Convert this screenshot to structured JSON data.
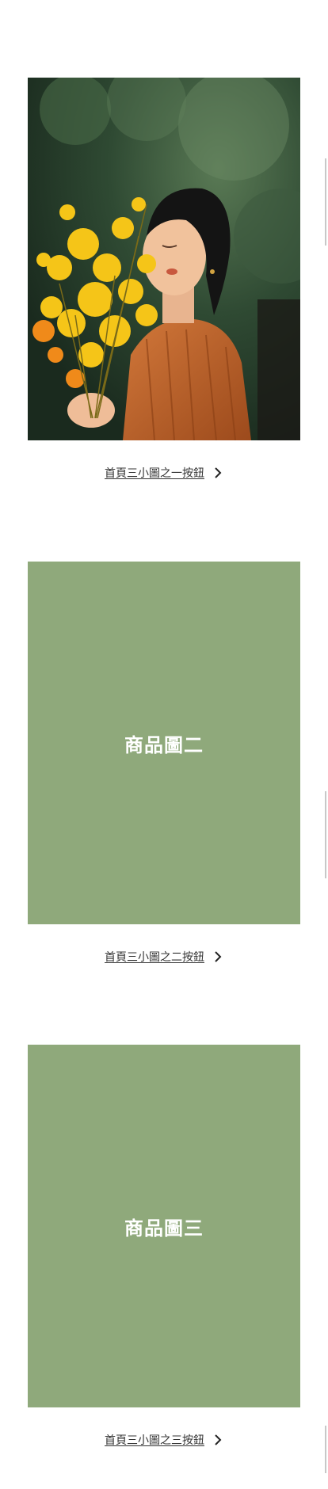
{
  "products": [
    {
      "image": {
        "type": "photo",
        "subject": "woman-with-yellow-flowers"
      },
      "button_label": "首頁三小圖之一按鈕"
    },
    {
      "image": {
        "type": "placeholder",
        "label": "商品圖二",
        "color": "#8fa97b"
      },
      "button_label": "首頁三小圖之二按鈕"
    },
    {
      "image": {
        "type": "placeholder",
        "label": "商品圖三",
        "color": "#8fa97b"
      },
      "button_label": "首頁三小圖之三按鈕"
    }
  ],
  "icons": {
    "chevron": "chevron-right-icon"
  }
}
